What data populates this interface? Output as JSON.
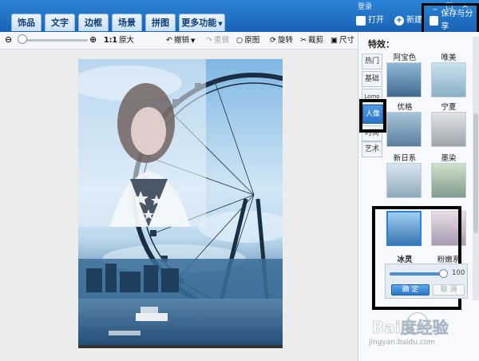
{
  "window": {
    "login": "登录",
    "minimize": "_",
    "maximize": "□",
    "close": "×"
  },
  "tabs": [
    {
      "label": "饰品"
    },
    {
      "label": "文字"
    },
    {
      "label": "边框"
    },
    {
      "label": "场景"
    },
    {
      "label": "拼图"
    },
    {
      "label": "更多功能",
      "has_dropdown": true
    }
  ],
  "header_actions": {
    "open": "打开",
    "new": "新建",
    "save_share": "保存与分享"
  },
  "toolbar": {
    "zoom_value": 0,
    "ratio": "1:1",
    "original_size": "原大",
    "undo": "撤销",
    "redo": "重做",
    "original_image": "原图",
    "rotate": "旋转",
    "crop": "裁剪",
    "size": "尺寸"
  },
  "panel": {
    "title": "特效：",
    "categories": [
      {
        "label": "热门",
        "active": false
      },
      {
        "label": "基础",
        "active": false
      },
      {
        "label": "Lomo",
        "active": false
      },
      {
        "label": "人像",
        "active": true
      },
      {
        "label": "时尚",
        "active": false
      },
      {
        "label": "艺术",
        "active": false
      }
    ],
    "effects": [
      {
        "label": "阿宝色",
        "selected": false
      },
      {
        "label": "唯美",
        "selected": false
      },
      {
        "label": "优格",
        "selected": false
      },
      {
        "label": "宁夏",
        "selected": false
      },
      {
        "label": "新日系",
        "selected": false
      },
      {
        "label": "墨染",
        "selected": false
      },
      {
        "label": "冰灵",
        "selected": true
      },
      {
        "label": "粉嫩系",
        "selected": false
      }
    ],
    "intensity": {
      "value": 100,
      "display": "100"
    },
    "confirm": "确 定",
    "cancel": "取 消"
  },
  "watermark": {
    "brand": "Bai度经验",
    "url": "jingyan.baidu.com"
  },
  "colors": {
    "accent": "#1a63b5",
    "highlight_border": "#000000"
  }
}
